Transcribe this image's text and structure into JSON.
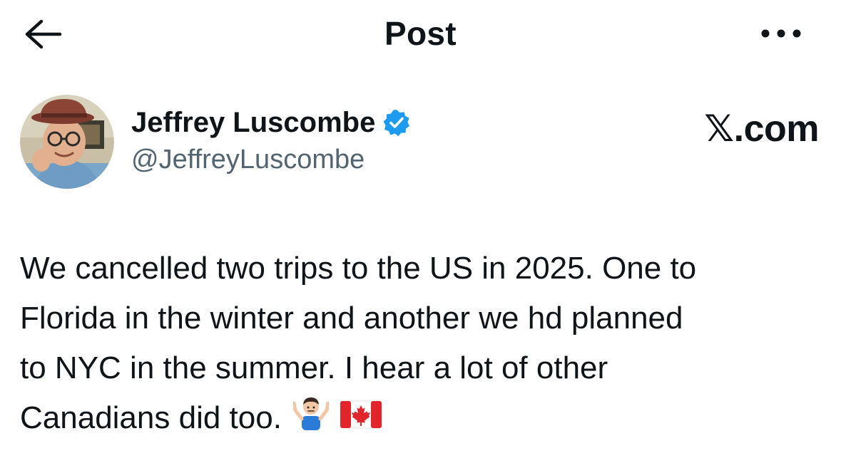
{
  "header": {
    "title": "Post",
    "back_icon": "arrow-left-icon",
    "more_icon": "more-horizontal-icon"
  },
  "author": {
    "display_name": "Jeffrey Luscombe",
    "handle": "@JeffreyLuscombe",
    "verified": true,
    "verified_color": "#1d9bf0"
  },
  "watermark": {
    "text": "𝕏.com"
  },
  "post": {
    "lines": [
      "We cancelled two trips to the US in 2025. One to",
      "Florida in the winter and another we hd planned",
      "to NYC  in the summer. I hear a lot of other",
      "Canadians did too."
    ],
    "emojis": [
      "man-shrugging-icon",
      "canada-flag-icon"
    ]
  },
  "colors": {
    "text_primary": "#0f1419",
    "text_secondary": "#536471",
    "accent": "#1d9bf0"
  }
}
